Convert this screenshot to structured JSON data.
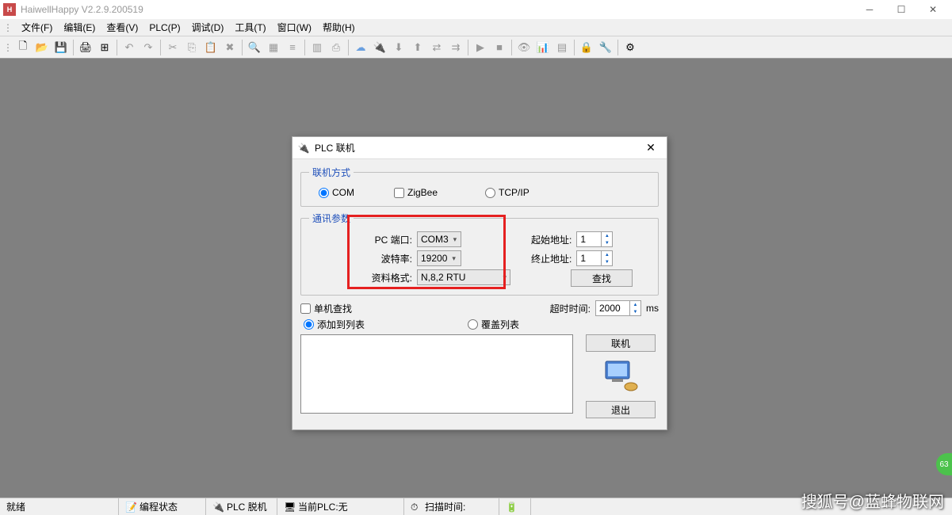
{
  "window": {
    "title": "HaiwellHappy V2.2.9.200519"
  },
  "menus": {
    "file": "文件(F)",
    "edit": "编辑(E)",
    "view": "查看(V)",
    "plc": "PLC(P)",
    "debug": "调试(D)",
    "tools": "工具(T)",
    "window": "窗口(W)",
    "help": "帮助(H)"
  },
  "dialog": {
    "title": "PLC 联机",
    "group_mode": "联机方式",
    "mode_com": "COM",
    "mode_zigbee": "ZigBee",
    "mode_tcpip": "TCP/IP",
    "group_params": "通讯参数",
    "pc_port_label": "PC 端口:",
    "pc_port_value": "COM3",
    "baud_label": "波特率:",
    "baud_value": "19200",
    "format_label": "资料格式:",
    "format_value": "N,8,2 RTU",
    "start_addr_label": "起始地址:",
    "start_addr_value": "1",
    "end_addr_label": "终止地址:",
    "end_addr_value": "1",
    "find_btn": "查找",
    "single_check": "单机查找",
    "timeout_label": "超时时间:",
    "timeout_value": "2000",
    "timeout_unit": "ms",
    "list_add": "添加到列表",
    "list_overwrite": "覆盖列表",
    "connect_btn": "联机",
    "exit_btn": "退出"
  },
  "status": {
    "ready": "就绪",
    "prog_state": "编程状态",
    "plc_offline": "PLC 脱机",
    "current_plc": "当前PLC:无",
    "scan_time": "扫描时间:"
  },
  "watermark": "搜狐号@蓝蜂物联网",
  "badge": "63"
}
